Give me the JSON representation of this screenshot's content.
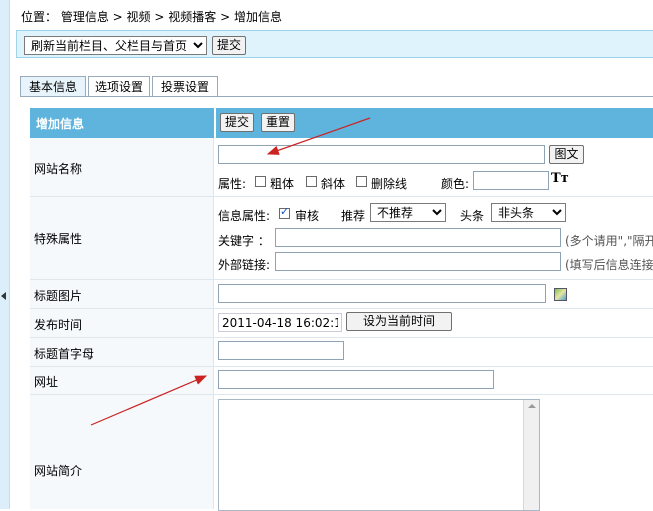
{
  "breadcrumb": {
    "prefix": "位置：",
    "items": [
      "管理信息",
      "视频",
      "视频播客",
      "增加信息"
    ],
    "sep": " > "
  },
  "refresh": {
    "selected": "刷新当前栏目、父栏目与首页",
    "submit": "提交"
  },
  "tabs": [
    "基本信息",
    "选项设置",
    "投票设置"
  ],
  "form_header": {
    "title": "增加信息",
    "submit": "提交",
    "reset": "重置"
  },
  "site_name": {
    "label": "网站名称",
    "value": "",
    "pic_button": "图文",
    "attr_label": "属性:",
    "bold": "粗体",
    "italic": "斜体",
    "strike": "删除线",
    "color_label": "颜色:",
    "color_value": "",
    "font_icon": "Tт"
  },
  "special": {
    "label": "特殊属性",
    "info_attr_label": "信息属性:",
    "review": "审核",
    "review_checked": true,
    "recommend_label": "推荐",
    "recommend_selected": "不推荐",
    "headline_label": "头条",
    "headline_selected": "非头条",
    "keyword_label": "关键字 ：",
    "keyword_value": "",
    "keyword_hint": "(多个请用\",\"隔开",
    "extlink_label": "外部链接:",
    "extlink_value": "",
    "extlink_hint": "(填写后信息连接"
  },
  "title_pic": {
    "label": "标题图片",
    "value": ""
  },
  "publish_time": {
    "label": "发布时间",
    "value": "2011-04-18 16:02:11",
    "button": "设为当前时间"
  },
  "initial": {
    "label": "标题首字母",
    "value": ""
  },
  "url": {
    "label": "网址",
    "value": ""
  },
  "intro": {
    "label": "网站简介",
    "value": ""
  },
  "colors": {
    "header_bg": "#5fb4dd",
    "arrow": "#cc2222"
  }
}
